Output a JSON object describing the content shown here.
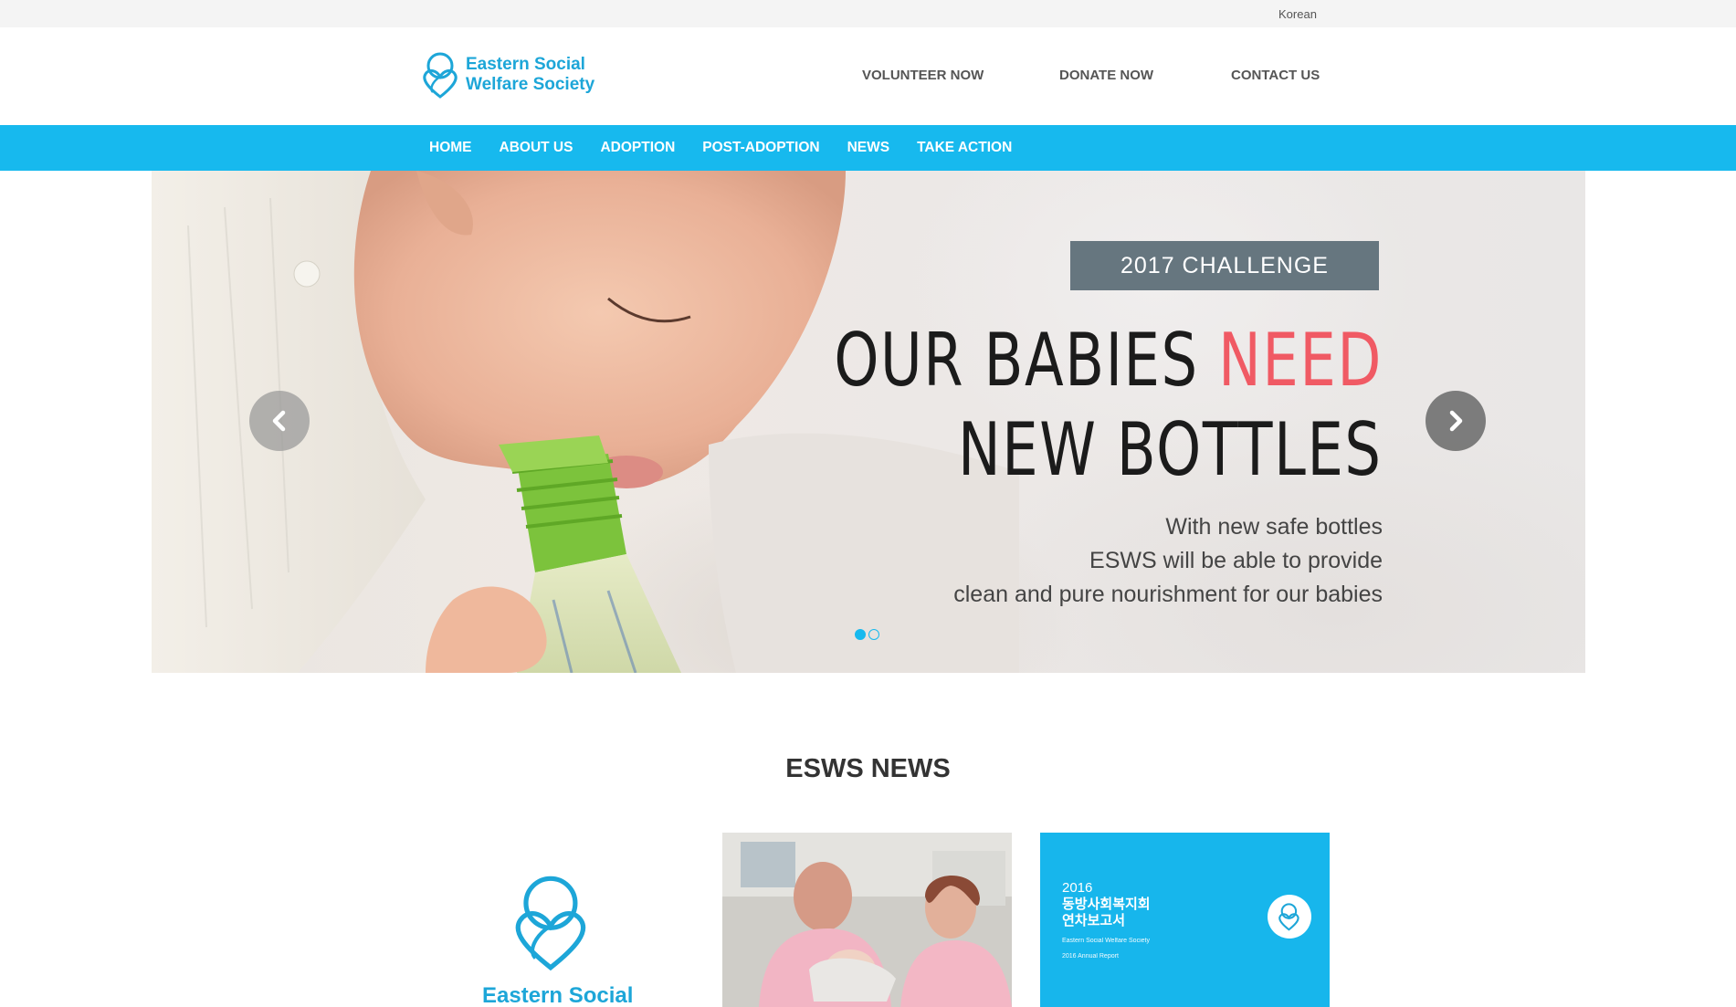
{
  "topbar": {
    "language_link": "Korean"
  },
  "header": {
    "logo_line1": "Eastern Social",
    "logo_line2": "Welfare Society",
    "utility_links": [
      "VOLUNTEER NOW",
      "DONATE NOW",
      "CONTACT US"
    ]
  },
  "main_nav": [
    "HOME",
    "ABOUT US",
    "ADOPTION",
    "POST-ADOPTION",
    "NEWS",
    "TAKE ACTION"
  ],
  "hero": {
    "badge": "2017 CHALLENGE",
    "headline_part1": "OUR BABIES ",
    "headline_highlight": "NEED",
    "headline_line2": "NEW BOTTLES",
    "subcopy": [
      "With new safe bottles",
      "ESWS will be able to provide",
      "clean and pure nourishment for our babies"
    ],
    "slide_count": 2,
    "active_slide": 1,
    "accent_color": "#17b9ee",
    "highlight_color": "#f05a64"
  },
  "news": {
    "title": "ESWS NEWS",
    "cards": [
      {
        "type": "logo",
        "logo_text": "Eastern Social"
      },
      {
        "type": "photo"
      },
      {
        "type": "report",
        "year": "2016",
        "korean_line1": "동방사회복지회",
        "korean_line2": "연차보고서",
        "english_line1": "Eastern Social Welfare Society",
        "english_line2": "2016 Annual Report"
      }
    ]
  },
  "colors": {
    "brand_blue": "#17b9ee",
    "logo_blue": "#1da6d8",
    "topbar_bg": "#f4f4f4"
  }
}
